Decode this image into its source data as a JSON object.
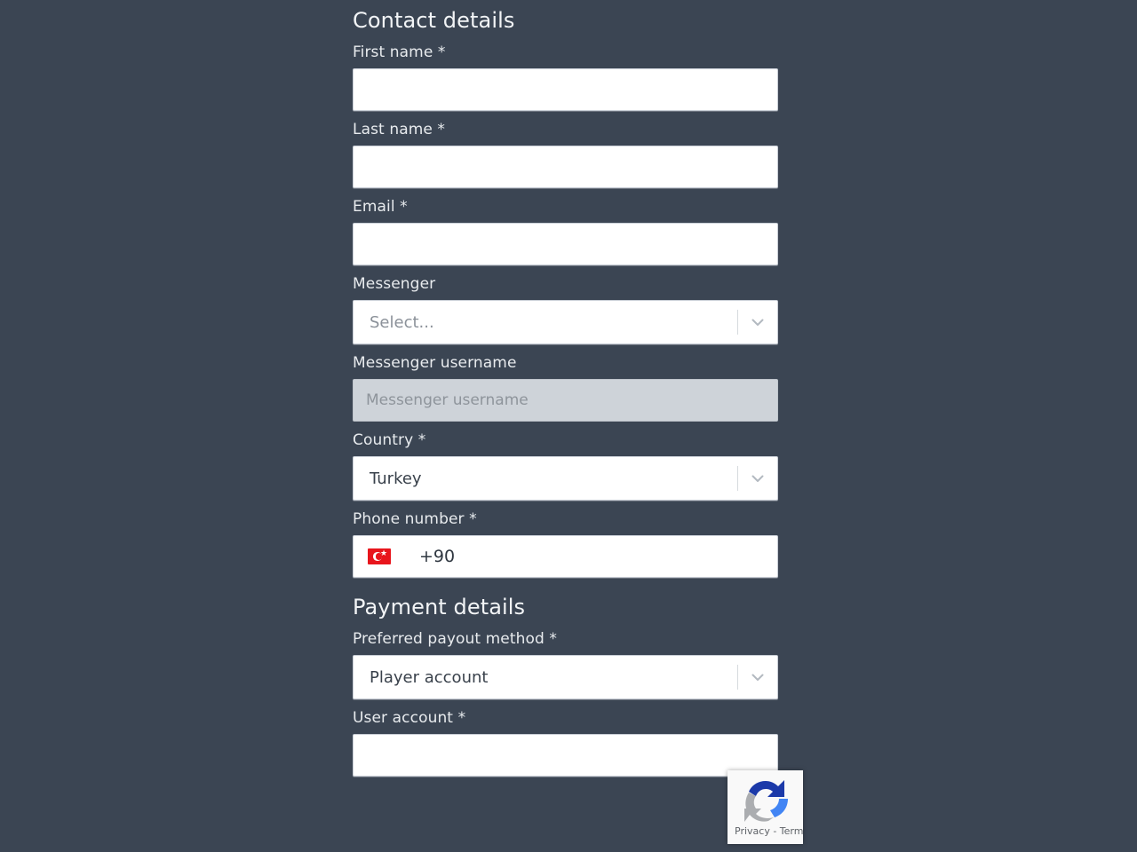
{
  "theme": {
    "page_background": "#3b4553",
    "input_background": "#ffffff",
    "disabled_input_background": "#ced3d9",
    "label_color": "#e8ebee",
    "heading_color": "#f2f4f6",
    "flag_red": "#e8151c",
    "recaptcha_blue": "#1c3aa9",
    "recaptcha_gray": "#9aa0a6"
  },
  "contact_section": {
    "heading": "Contact details",
    "fields": {
      "first_name": {
        "label": "First name *",
        "value": "",
        "placeholder": ""
      },
      "last_name": {
        "label": "Last name *",
        "value": "",
        "placeholder": ""
      },
      "email": {
        "label": "Email *",
        "value": "",
        "placeholder": ""
      },
      "messenger": {
        "label": "Messenger",
        "selected": "Select...",
        "is_placeholder": true,
        "arrow_icon": "chevron-down-icon"
      },
      "messenger_username": {
        "label": "Messenger username",
        "value": "",
        "placeholder": "Messenger username",
        "disabled": true
      },
      "country": {
        "label": "Country *",
        "selected": "Turkey",
        "is_placeholder": false,
        "arrow_icon": "chevron-down-icon"
      },
      "phone_number": {
        "label": "Phone number *",
        "flag_icon": "flag-turkey-icon",
        "dial_code": "+90",
        "value": ""
      }
    }
  },
  "payment_section": {
    "heading": "Payment details",
    "fields": {
      "payout_method": {
        "label": "Preferred payout method *",
        "selected": "Player account",
        "is_placeholder": false,
        "arrow_icon": "chevron-down-icon"
      },
      "user_account": {
        "label": "User account *",
        "value": "",
        "placeholder": ""
      }
    }
  },
  "recaptcha": {
    "logo_icon": "recaptcha-logo-icon",
    "links_text": "Privacy - Terms"
  }
}
